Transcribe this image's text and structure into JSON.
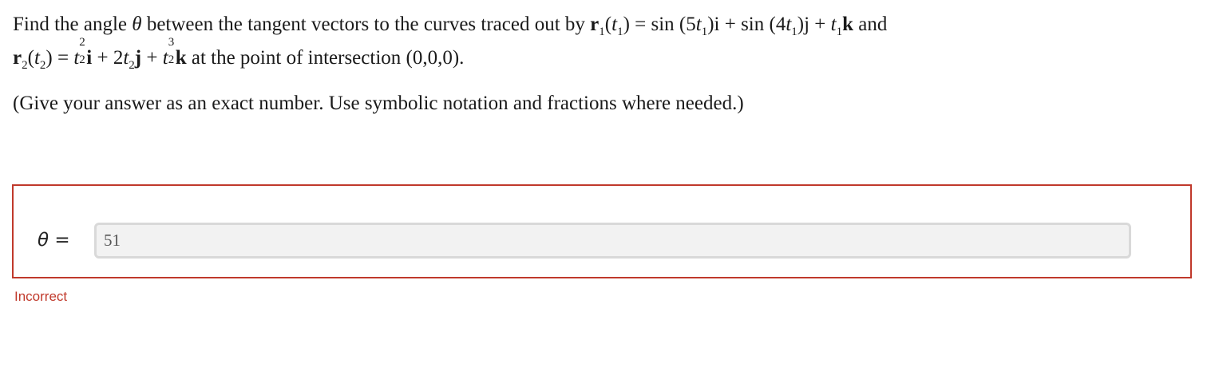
{
  "question": {
    "intro": "Find the angle",
    "theta": "θ",
    "mid": "between the tangent vectors to the curves traced out by",
    "r1_vec": "r",
    "r1_sub": "1",
    "r1_arg": "(t",
    "r1_arg_sub": "1",
    "r1_arg_close": ")",
    "r1_rhs": "= sin (5t",
    "r1_rhs_sub1": "1",
    "r1_rhs_mid1": ")i + sin (4t",
    "r1_rhs_sub2": "1",
    "r1_rhs_mid2": ")j + t",
    "r1_rhs_sub3": "1",
    "r1_rhs_end": "k",
    "and": "and",
    "r2_vec": "r",
    "r2_sub": "2",
    "r2_arg": "(t",
    "r2_arg_sub": "2",
    "r2_arg_close": ")",
    "r2_eq": "=",
    "r2_t1": "t",
    "r2_t1_sup": "2",
    "r2_t1_sub": "2",
    "r2_i": "i",
    "r2_plus1": "+ 2t",
    "r2_t2_sub": "2",
    "r2_j": "j",
    "r2_plus2": "+",
    "r2_t3": "t",
    "r2_t3_sup": "3",
    "r2_t3_sub": "2",
    "r2_k": "k",
    "tail": "at the point of intersection (0,0,0)."
  },
  "instructions": "(Give your answer as an exact number. Use symbolic notation and fractions where needed.)",
  "answer": {
    "label_symbol": "θ",
    "label_equals": "=",
    "value": "51"
  },
  "status": {
    "text": "Incorrect",
    "color": "#c0392b"
  }
}
